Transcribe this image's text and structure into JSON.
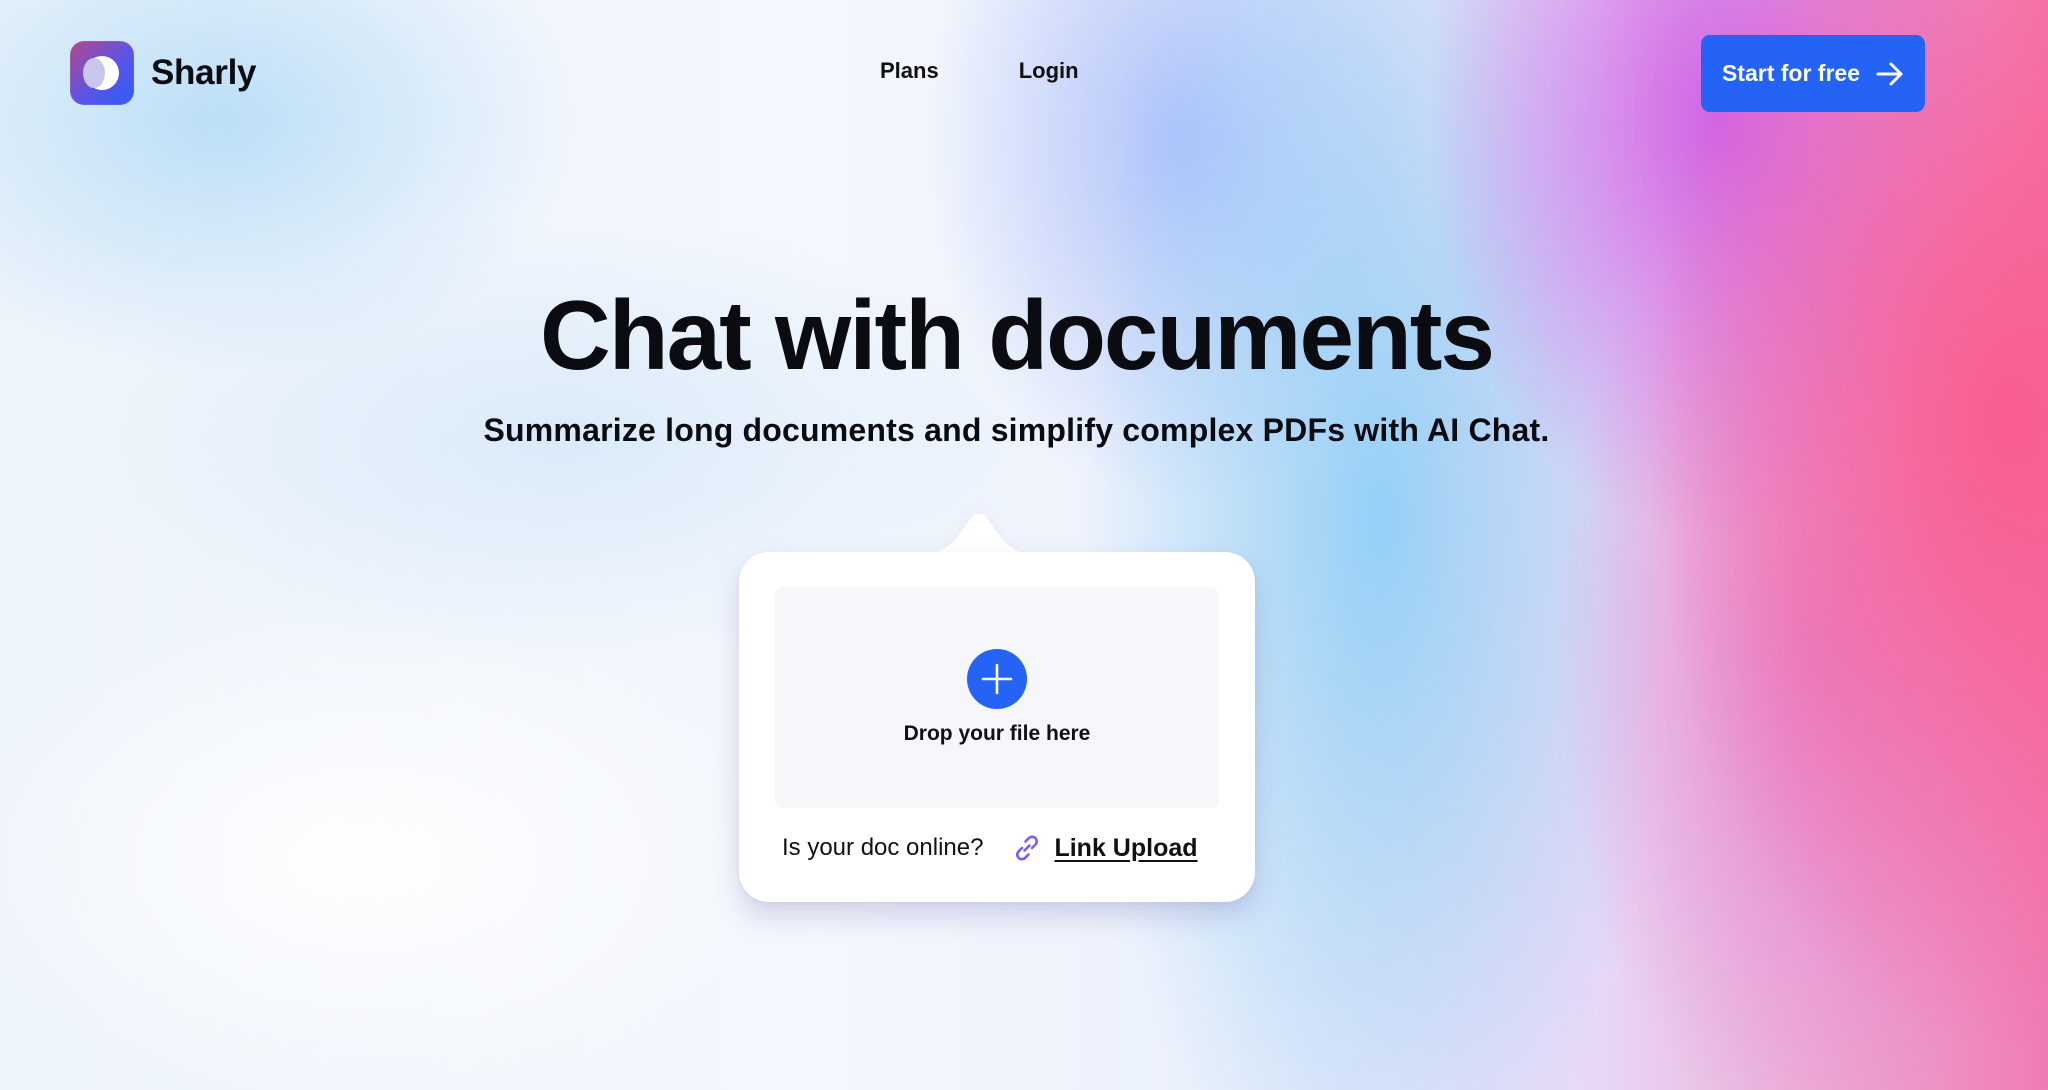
{
  "header": {
    "brand": "Sharly",
    "nav": [
      {
        "label": "Plans"
      },
      {
        "label": "Login"
      }
    ],
    "cta_label": "Start for free"
  },
  "hero": {
    "title": "Chat with documents",
    "subtitle": "Summarize long documents and simplify complex PDFs with AI Chat."
  },
  "upload": {
    "drop_label": "Drop your file here",
    "online_question": "Is your doc online?",
    "link_label": "Link Upload"
  },
  "icons": {
    "logo": "sharly-logo-icon",
    "cta_arrow": "arrow-right-icon",
    "add": "plus-icon",
    "link": "link-icon"
  },
  "colors": {
    "primary": "#2563f5",
    "link_icon": "#7c5cf0",
    "card": "#ffffff",
    "dropzone": "#f6f7fb"
  }
}
